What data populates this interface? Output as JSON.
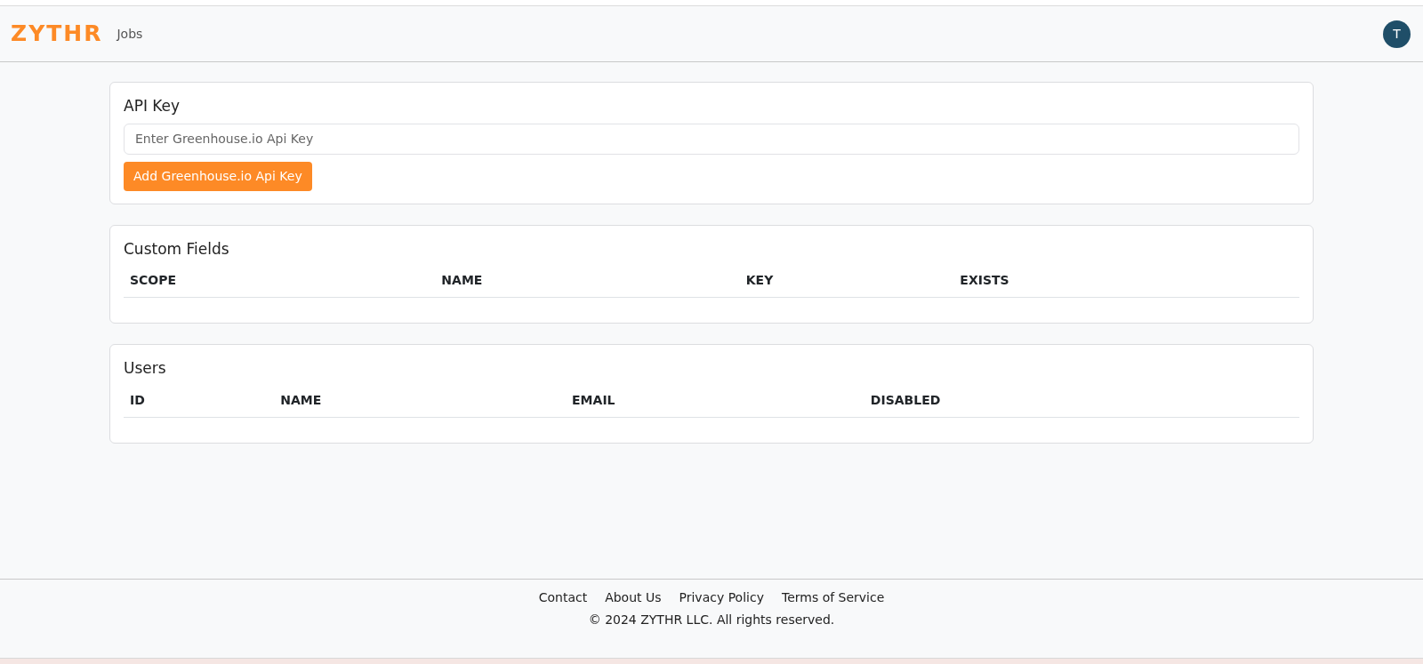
{
  "navbar": {
    "logo": "ZYTHR",
    "links": [
      {
        "label": "Jobs"
      }
    ],
    "avatar": "T"
  },
  "api_key": {
    "title": "API Key",
    "input": {
      "placeholder": "Enter Greenhouse.io Api Key"
    },
    "button": "Add Greenhouse.io Api Key"
  },
  "custom_fields": {
    "title": "Custom Fields",
    "table": {
      "columns": [
        "SCOPE",
        "NAME",
        "KEY",
        "EXISTS"
      ]
    }
  },
  "users": {
    "title": "Users",
    "table": {
      "columns": [
        "ID",
        "NAME",
        "EMAIL",
        "DISABLED"
      ]
    }
  },
  "footer": {
    "links": [
      "Contact",
      "About Us",
      "Privacy Policy",
      "Terms of Service"
    ],
    "copyright": "© 2024 ZYTHR LLC. All rights reserved."
  }
}
